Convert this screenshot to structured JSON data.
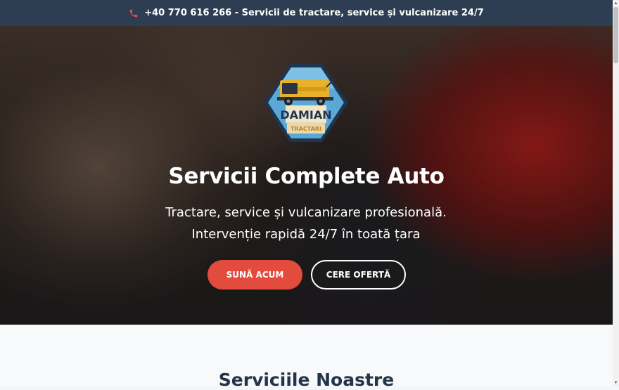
{
  "topbar": {
    "text": "+40 770 616 266 - Servicii de tractare, service și vulcanizare 24/7",
    "icon": "phone-icon",
    "icon_color": "#e84a5f",
    "background": "#2e3e52"
  },
  "logo": {
    "name": "DAMIAN",
    "subtitle": "TRACTARI"
  },
  "hero": {
    "title": "Servicii Complete Auto",
    "subtitle": "Tractare, service și vulcanizare profesională. Intervenție rapidă 24/7 în toată țara"
  },
  "buttons": {
    "call_label": "SUNĂ ACUM",
    "offer_label": "CERE OFERTĂ",
    "call_color": "#e34b3d"
  },
  "services": {
    "title": "Serviciile Noastre"
  }
}
